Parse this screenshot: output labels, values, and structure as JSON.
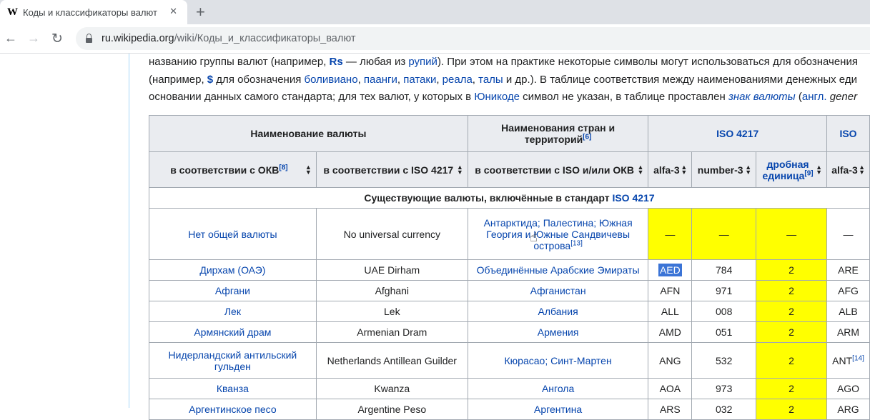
{
  "browser": {
    "tab_icon": "W",
    "tab_title": "Коды и классификаторы валют",
    "tab_close": "✕",
    "new_tab": "+",
    "url_domain": "ru.wikipedia.org",
    "url_path": "/wiki/Коды_и_классификаторы_валют"
  },
  "article": {
    "line1": {
      "t1": "названию группы валют (например, ",
      "b1": "Rs",
      "t2": " — любая из ",
      "l1": "рупий",
      "t3": "). При этом на практике некоторые символы могут использоваться для обозначения"
    },
    "line2": {
      "t1": "(например, ",
      "b1": "$",
      "t2": " для обозначения ",
      "l1": "боливиано",
      "t3": ", ",
      "l2": "паанги",
      "t4": ", ",
      "l3": "патаки",
      "t5": ", ",
      "l4": "реала",
      "t6": ", ",
      "l5": "талы",
      "t7": " и др.). В таблице соответствия между наименованиями денежных еди"
    },
    "line3": {
      "t1": "основании данных самого стандарта; для тех валют, у которых в ",
      "l1": "Юникоде",
      "t2": " символ не указан, в таблице проставлен ",
      "l2": "знак валюты",
      "t3": " (",
      "l3": "англ.",
      "t4": " gener"
    }
  },
  "table": {
    "h_currency": "Наименование валюты",
    "h_countries": "Наименования стран и территорий",
    "h_countries_ref": "[6]",
    "h_iso": "ISO 4217",
    "h_iso2": "ISO",
    "sub_okv": "в соответствии с ОКВ",
    "sub_okv_ref": "[8]",
    "sub_iso": "в соответствии с ISO 4217",
    "sub_iso_okv": "в соответствии с ISO и/или ОКВ",
    "sub_alfa": "alfa-3",
    "sub_number": "number-3",
    "sub_minor": "дробная единица",
    "sub_minor_ref": "[9]",
    "sub_alfa2": "alfa-3",
    "section_text": "Существующие валюты, включённые в стандарт ",
    "section_link": "ISO 4217",
    "rows": [
      {
        "okv": "Нет общей валюты",
        "iso": "No universal currency",
        "country": "Антарктида; Палестина; Южная Георгия и Южные Сандвичевы острова",
        "ref": "[13]",
        "alfa": "—",
        "num": "—",
        "minor": "—",
        "alfa2": "—",
        "ref2": ""
      },
      {
        "okv": "Дирхам (ОАЭ)",
        "iso": "UAE Dirham",
        "country": "Объединённые Арабские Эмираты",
        "ref": "",
        "alfa": "AED",
        "num": "784",
        "minor": "2",
        "alfa2": "ARE",
        "ref2": ""
      },
      {
        "okv": "Афгани",
        "iso": "Afghani",
        "country": "Афганистан",
        "ref": "",
        "alfa": "AFN",
        "num": "971",
        "minor": "2",
        "alfa2": "AFG",
        "ref2": ""
      },
      {
        "okv": "Лек",
        "iso": "Lek",
        "country": "Албания",
        "ref": "",
        "alfa": "ALL",
        "num": "008",
        "minor": "2",
        "alfa2": "ALB",
        "ref2": ""
      },
      {
        "okv": "Армянский драм",
        "iso": "Armenian Dram",
        "country": "Армения",
        "ref": "",
        "alfa": "AMD",
        "num": "051",
        "minor": "2",
        "alfa2": "ARM",
        "ref2": ""
      },
      {
        "okv": "Нидерландский антильский гульден",
        "iso": "Netherlands Antillean Guilder",
        "country": "Кюрасао; Синт-Мартен",
        "ref": "",
        "alfa": "ANG",
        "num": "532",
        "minor": "2",
        "alfa2": "ANT",
        "ref2": "[14]"
      },
      {
        "okv": "Кванза",
        "iso": "Kwanza",
        "country": "Ангола",
        "ref": "",
        "alfa": "AOA",
        "num": "973",
        "minor": "2",
        "alfa2": "AGO",
        "ref2": ""
      },
      {
        "okv": "Аргентинское песо",
        "iso": "Argentine Peso",
        "country": "Аргентина",
        "ref": "",
        "alfa": "ARS",
        "num": "032",
        "minor": "2",
        "alfa2": "ARG",
        "ref2": ""
      }
    ]
  }
}
